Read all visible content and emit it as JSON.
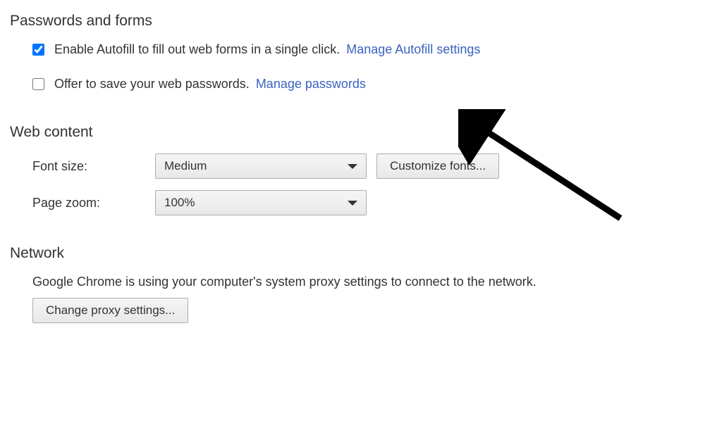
{
  "sections": {
    "passwords": {
      "heading": "Passwords and forms",
      "autofill": {
        "checked": true,
        "label_prefix": "Enable Autofill to fill out web forms in a single click.",
        "link_text": "Manage Autofill settings"
      },
      "save_passwords": {
        "checked": false,
        "label_prefix": "Offer to save your web passwords.",
        "link_text": "Manage passwords"
      }
    },
    "web_content": {
      "heading": "Web content",
      "font_size": {
        "label": "Font size:",
        "value": "Medium",
        "customize_button": "Customize fonts..."
      },
      "page_zoom": {
        "label": "Page zoom:",
        "value": "100%"
      }
    },
    "network": {
      "heading": "Network",
      "description": "Google Chrome is using your computer's system proxy settings to connect to the network.",
      "button": "Change proxy settings..."
    }
  }
}
